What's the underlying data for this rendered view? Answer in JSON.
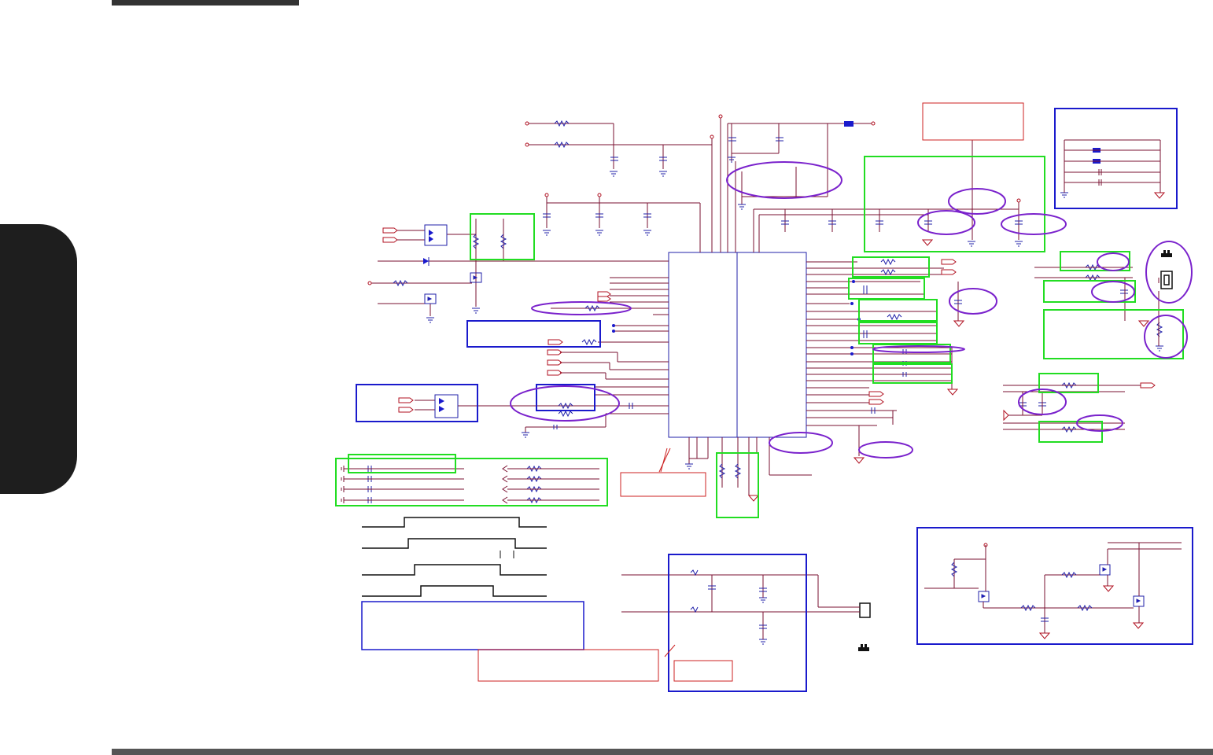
{
  "document": {
    "type": "circuit schematic page",
    "colors": {
      "wire": "#b01020",
      "component": "#2222aa",
      "highlight_box_green": "#22dd22",
      "highlight_box_blue": "#1a1acc",
      "highlight_ellipse": "#7a22cc",
      "note_box_red": "#cc2222",
      "chrome": "#1e1e1e"
    },
    "icons": [
      "resistor-icon",
      "capacitor-icon",
      "ground-icon",
      "mosfet-icon",
      "diode-icon",
      "connector-icon"
    ]
  }
}
